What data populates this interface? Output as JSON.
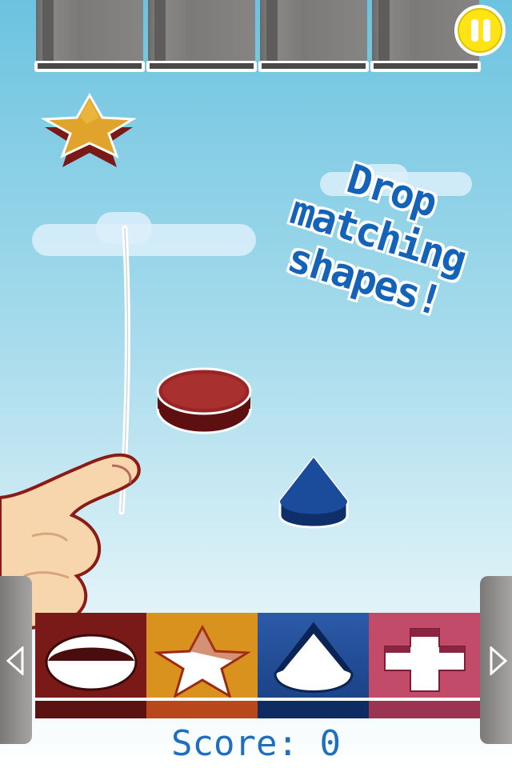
{
  "game": {
    "hint_line1": "Drop",
    "hint_line2": "matching",
    "hint_line3": "shapes!",
    "score_label": "Score:",
    "score_value": "0",
    "pause_icon": "pause-icon",
    "left_arrow_icon": "chevron-left-icon",
    "right_arrow_icon": "chevron-right-icon"
  },
  "falling_shapes": [
    {
      "shape": "star",
      "color": "#d99a25"
    },
    {
      "shape": "circle",
      "color": "#8c1d1d"
    },
    {
      "shape": "drop",
      "color": "#123f86"
    }
  ],
  "bins": [
    {
      "shape": "circle",
      "color": "#7a1a18"
    },
    {
      "shape": "star",
      "color": "#d9921e"
    },
    {
      "shape": "drop",
      "color": "#163e80"
    },
    {
      "shape": "plus",
      "color": "#c24b6a"
    }
  ],
  "colors": {
    "sky_top": "#6cc3e0",
    "pause_yellow": "#ffe415",
    "text_blue": "#1463b8"
  }
}
